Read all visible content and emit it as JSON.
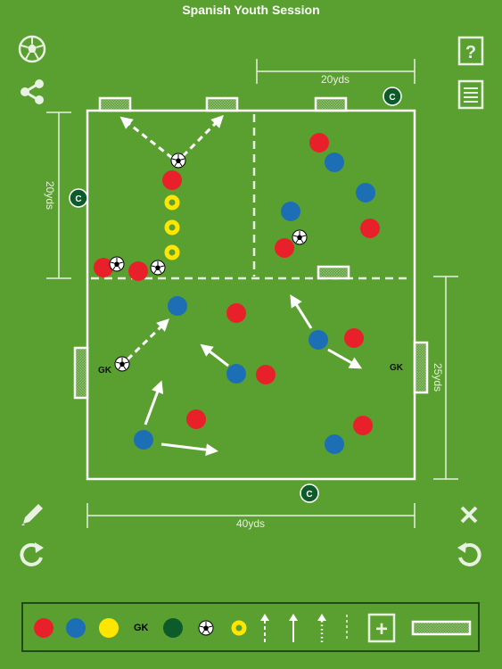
{
  "title": "Spanish Youth Session",
  "colors": {
    "background": "#5aa030",
    "line": "#ffffff",
    "dim_line": "#e8f0e0",
    "red": "#e8202a",
    "blue": "#1c6fb4",
    "yellow": "#ffe600",
    "coach": "#0d5a2a",
    "palette_border": "#1f4a10"
  },
  "icons": {
    "left_top": "soccer-ball-icon",
    "left_share": "share-icon",
    "right_help": "help-icon",
    "right_notes": "notes-icon",
    "left_pencil": "pencil-icon",
    "right_close": "close-icon",
    "left_redo": "redo-icon",
    "right_undo": "undo-icon"
  },
  "help_glyph": "?",
  "dimensions": {
    "top_right": "20yds",
    "left": "20yds",
    "right": "25yds",
    "bottom": "40yds"
  },
  "labels": {
    "gk_left": "GK",
    "gk_right": "GK",
    "coach": "C"
  },
  "palette": {
    "gk_label": "GK",
    "add_glyph": "+",
    "items": [
      "red-player",
      "blue-player",
      "yellow-player",
      "gk-label",
      "coach-marker",
      "ball",
      "cone",
      "dashed-arrow",
      "solid-arrow",
      "dotted-arrow",
      "add-button",
      "goal"
    ]
  }
}
